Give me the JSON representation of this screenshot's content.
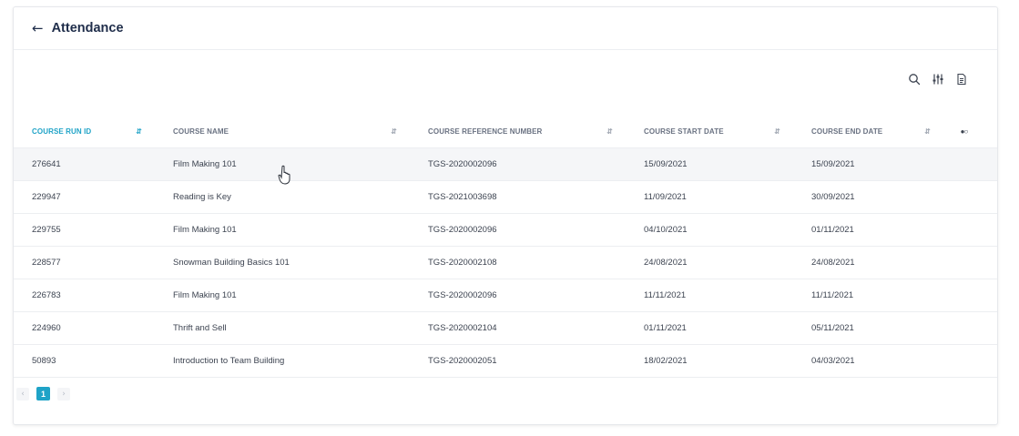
{
  "header": {
    "back_icon": "arrow-left-icon",
    "title": "Attendance"
  },
  "toolbar": {
    "icons": [
      "search-icon",
      "column-settings-icon",
      "export-icon"
    ]
  },
  "table": {
    "columns": [
      {
        "label": "COURSE RUN ID",
        "active": true
      },
      {
        "label": "COURSE NAME",
        "active": false
      },
      {
        "label": "COURSE REFERENCE NUMBER",
        "active": false
      },
      {
        "label": "COURSE START DATE",
        "active": false
      },
      {
        "label": "COURSE END DATE",
        "active": false
      }
    ],
    "rows": [
      [
        "276641",
        "Film Making 101",
        "TGS-2020002096",
        "15/09/2021",
        "15/09/2021"
      ],
      [
        "229947",
        "Reading is Key",
        "TGS-2021003698",
        "11/09/2021",
        "30/09/2021"
      ],
      [
        "229755",
        "Film Making 101",
        "TGS-2020002096",
        "04/10/2021",
        "01/11/2021"
      ],
      [
        "228577",
        "Snowman Building Basics 101",
        "TGS-2020002108",
        "24/08/2021",
        "24/08/2021"
      ],
      [
        "226783",
        "Film Making 101",
        "TGS-2020002096",
        "11/11/2021",
        "11/11/2021"
      ],
      [
        "224960",
        "Thrift and Sell",
        "TGS-2020002104",
        "01/11/2021",
        "05/11/2021"
      ],
      [
        "50893",
        "Introduction to Team Building",
        "TGS-2020002051",
        "18/02/2021",
        "04/03/2021"
      ]
    ]
  },
  "pagination": {
    "prev": "‹",
    "current_page": "1",
    "next": "›"
  },
  "colors": {
    "accent": "#1fa3c7",
    "title": "#1f2d4a",
    "text": "#3c4350",
    "hover_row": "#f5f6f8"
  }
}
